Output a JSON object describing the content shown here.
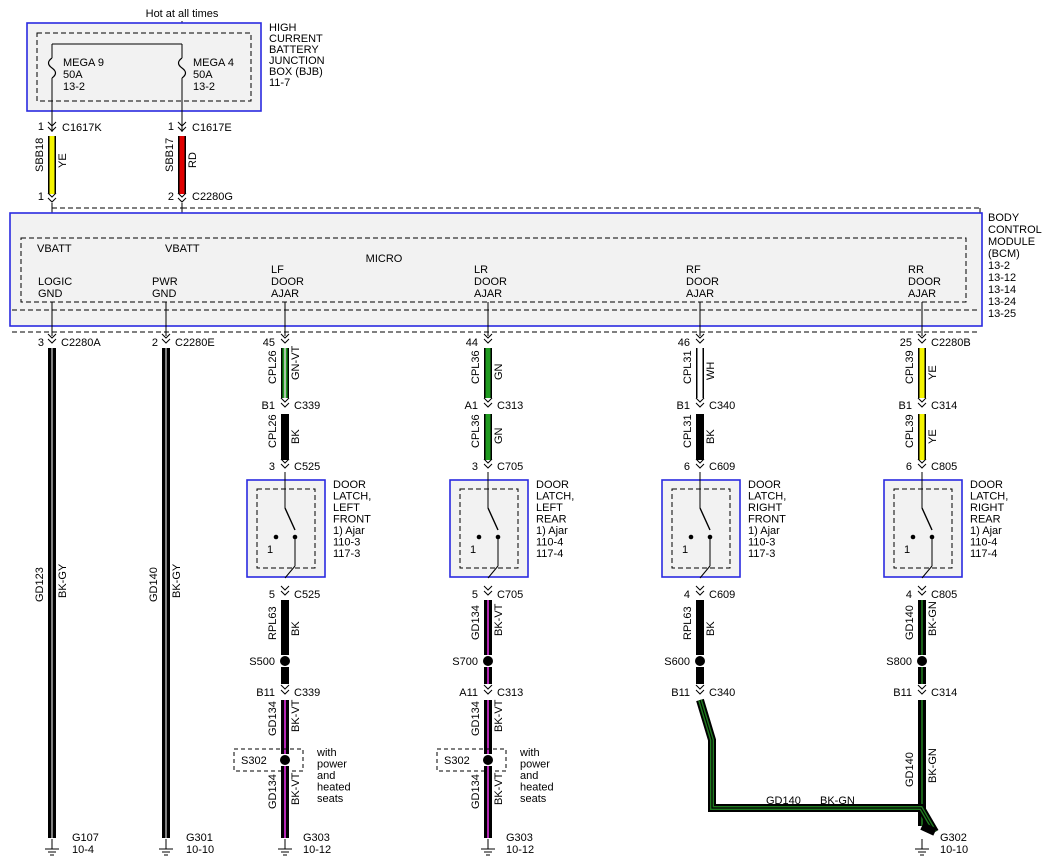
{
  "power_source": "Hot at all times",
  "bjb": {
    "title": [
      "HIGH",
      "CURRENT",
      "BATTERY",
      "JUNCTION",
      "BOX (BJB)",
      "11-7"
    ],
    "fuses": [
      {
        "name": "MEGA 9",
        "rating": "50A",
        "page": "13-2"
      },
      {
        "name": "MEGA 4",
        "rating": "50A",
        "page": "13-2"
      }
    ]
  },
  "feed_wires": [
    {
      "top_pin": "1",
      "top_conn": "C1617K",
      "circuit": "SBB18",
      "color_code": "YE",
      "color": "#f4f400",
      "bot_pin": "1",
      "bot_conn": ""
    },
    {
      "top_pin": "1",
      "top_conn": "C1617E",
      "circuit": "SBB17",
      "color_code": "RD",
      "color": "#e00000",
      "bot_pin": "2",
      "bot_conn": "C2280G"
    }
  ],
  "bcm": {
    "title": [
      "BODY",
      "CONTROL",
      "MODULE",
      "(BCM)",
      "13-2",
      "13-12",
      "13-14",
      "13-24",
      "13-25"
    ],
    "micro_label": "MICRO",
    "vbatt": [
      "VBATT",
      "VBATT"
    ],
    "ports": [
      [
        "LOGIC",
        "GND"
      ],
      [
        "PWR",
        "GND"
      ],
      [
        "LF",
        "DOOR",
        "AJAR"
      ],
      [
        "LR",
        "DOOR",
        "AJAR"
      ],
      [
        "RF",
        "DOOR",
        "AJAR"
      ],
      [
        "RR",
        "DOOR",
        "AJAR"
      ]
    ]
  },
  "ground_wires": [
    {
      "pin": "3",
      "conn": "C2280A",
      "circuit": "GD123",
      "color_code": "BK-GY",
      "ground": "G107",
      "page": "10-4"
    },
    {
      "pin": "2",
      "conn": "C2280E",
      "circuit": "GD140",
      "color_code": "BK-GY",
      "ground": "G301",
      "page": "10-10"
    }
  ],
  "doors": [
    {
      "bcm_pin": "45",
      "bcm_conn": "",
      "w1": {
        "circuit": "CPL26",
        "code": "GN-VT",
        "color": "#1f9a1f",
        "stripe": "#cfcfcf"
      },
      "inline_pin": "B1",
      "inline_conn": "C339",
      "w2": {
        "circuit": "CPL26",
        "code": "BK",
        "color": "#000000",
        "stripe": ""
      },
      "latch_pin_in": "3",
      "latch_conn": "C525",
      "latch_label": [
        "DOOR",
        "LATCH,",
        "LEFT",
        "FRONT",
        "1) Ajar",
        "110-3",
        "117-3"
      ],
      "switch_num": "1",
      "latch_pin_out": "5",
      "latch_conn_out": "C525",
      "w3": {
        "circuit": "RPL63",
        "code": "BK",
        "color": "#000000",
        "stripe": ""
      },
      "splice": "S500",
      "pin2": "B11",
      "conn2": "C339",
      "w4": {
        "circuit": "GD134",
        "code": "BK-VT",
        "color": "#000000",
        "stripe": "#e030e0"
      },
      "opt_splice": "S302",
      "opt_note": [
        "with",
        "power",
        "and",
        "heated",
        "seats"
      ],
      "w5": {
        "circuit": "GD134",
        "code": "BK-VT",
        "color": "#000000",
        "stripe": "#e030e0"
      },
      "ground": "G303",
      "ground_page": "10-12"
    },
    {
      "bcm_pin": "44",
      "bcm_conn": "",
      "w1": {
        "circuit": "CPL36",
        "code": "GN",
        "color": "#1f9a1f",
        "stripe": ""
      },
      "inline_pin": "A1",
      "inline_conn": "C313",
      "w2": {
        "circuit": "CPL36",
        "code": "GN",
        "color": "#1f9a1f",
        "stripe": ""
      },
      "latch_pin_in": "3",
      "latch_conn": "C705",
      "latch_label": [
        "DOOR",
        "LATCH,",
        "LEFT",
        "REAR",
        "1) Ajar",
        "110-4",
        "117-4"
      ],
      "switch_num": "1",
      "latch_pin_out": "5",
      "latch_conn_out": "C705",
      "w3": {
        "circuit": "GD134",
        "code": "BK-VT",
        "color": "#000000",
        "stripe": "#e030e0"
      },
      "splice": "S700",
      "pin2": "A11",
      "conn2": "C313",
      "w4": {
        "circuit": "GD134",
        "code": "BK-VT",
        "color": "#000000",
        "stripe": "#e030e0"
      },
      "opt_splice": "S302",
      "opt_note": [
        "with",
        "power",
        "and",
        "heated",
        "seats"
      ],
      "w5": {
        "circuit": "GD134",
        "code": "BK-VT",
        "color": "#000000",
        "stripe": "#e030e0"
      },
      "ground": "G303",
      "ground_page": "10-12"
    },
    {
      "bcm_pin": "46",
      "bcm_conn": "",
      "w1": {
        "circuit": "CPL31",
        "code": "WH",
        "color": "#ffffff",
        "stripe": ""
      },
      "inline_pin": "B1",
      "inline_conn": "C340",
      "w2": {
        "circuit": "CPL31",
        "code": "BK",
        "color": "#000000",
        "stripe": ""
      },
      "latch_pin_in": "6",
      "latch_conn": "C609",
      "latch_label": [
        "DOOR",
        "LATCH,",
        "RIGHT",
        "FRONT",
        "1) Ajar",
        "110-3",
        "117-3"
      ],
      "switch_num": "1",
      "latch_pin_out": "4",
      "latch_conn_out": "C609",
      "w3": {
        "circuit": "RPL63",
        "code": "BK",
        "color": "#000000",
        "stripe": ""
      },
      "splice": "S600",
      "pin2": "B11",
      "conn2": "C340",
      "ground": "",
      "ground_page": ""
    },
    {
      "bcm_pin": "25",
      "bcm_conn": "C2280B",
      "w1": {
        "circuit": "CPL39",
        "code": "YE",
        "color": "#f4f400",
        "stripe": ""
      },
      "inline_pin": "B1",
      "inline_conn": "C314",
      "w2": {
        "circuit": "CPL39",
        "code": "YE",
        "color": "#f4f400",
        "stripe": ""
      },
      "latch_pin_in": "6",
      "latch_conn": "C805",
      "latch_label": [
        "DOOR",
        "LATCH,",
        "RIGHT",
        "REAR",
        "1) Ajar",
        "110-4",
        "117-4"
      ],
      "switch_num": "1",
      "latch_pin_out": "4",
      "latch_conn_out": "C805",
      "w3": {
        "circuit": "GD140",
        "code": "BK-GN",
        "color": "#000000",
        "stripe": "#1f7a1f"
      },
      "splice": "S800",
      "pin2": "B11",
      "conn2": "C314",
      "w4": {
        "circuit": "GD140",
        "code": "BK-GN",
        "color": "#000000",
        "stripe": "#1f7a1f"
      },
      "ground": "G302",
      "ground_page": "10-10"
    }
  ],
  "crossover": {
    "circuit": "GD140",
    "code": "BK-GN",
    "color": "#000000",
    "stripe": "#1f7a1f"
  }
}
